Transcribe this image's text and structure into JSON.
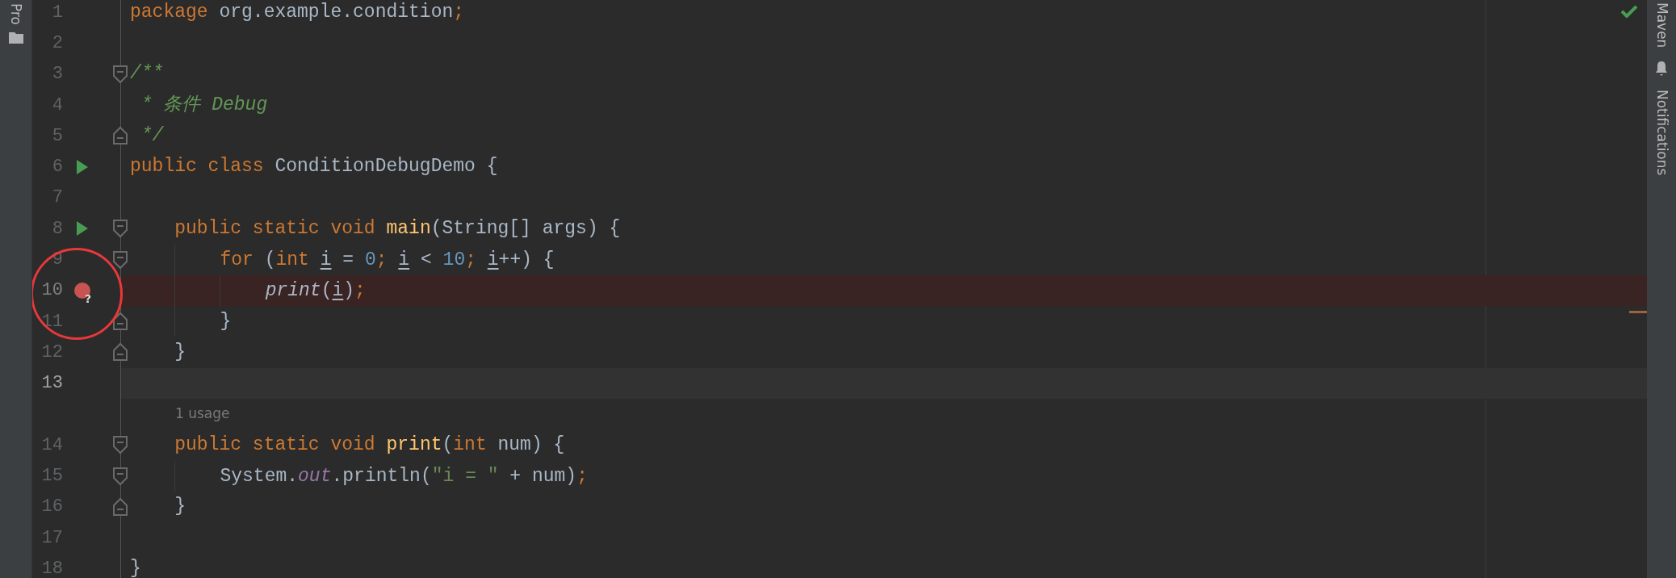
{
  "left_toolbar": {
    "label": "Pro"
  },
  "right_toolbar": {
    "labels": [
      "Maven",
      "Notifications"
    ]
  },
  "editor": {
    "rows": [
      {
        "kind": "code",
        "number": "1",
        "current": false,
        "breakpoint_line": false,
        "run": false,
        "breakpoint": false,
        "fold_start": false,
        "fold_end": false,
        "tokens": [
          {
            "t": "package ",
            "color": "#cc7832"
          },
          {
            "t": "org.example.condition",
            "color": "#a9b7c6"
          },
          {
            "t": ";",
            "color": "#cc7832"
          }
        ]
      },
      {
        "kind": "code",
        "number": "2",
        "current": false,
        "breakpoint_line": false,
        "run": false,
        "breakpoint": false,
        "fold_start": false,
        "fold_end": false
      },
      {
        "kind": "code",
        "number": "3",
        "current": false,
        "breakpoint_line": false,
        "run": false,
        "breakpoint": false,
        "fold_start": true,
        "fold_end": false,
        "tokens": [
          {
            "t": "/**",
            "color": "#629755",
            "italic": true
          }
        ]
      },
      {
        "kind": "code",
        "number": "4",
        "current": false,
        "breakpoint_line": false,
        "run": false,
        "breakpoint": false,
        "fold_start": false,
        "fold_end": false,
        "tokens": [
          {
            "t": " * 条件 Debug",
            "color": "#629755",
            "italic": true
          }
        ]
      },
      {
        "kind": "code",
        "number": "5",
        "current": false,
        "breakpoint_line": false,
        "run": false,
        "breakpoint": false,
        "fold_start": false,
        "fold_end": true,
        "tokens": [
          {
            "t": " */",
            "color": "#629755",
            "italic": true
          }
        ]
      },
      {
        "kind": "code",
        "number": "6",
        "current": false,
        "breakpoint_line": false,
        "run": true,
        "breakpoint": false,
        "fold_start": false,
        "fold_end": false,
        "tokens": [
          {
            "t": "public class ",
            "color": "#cc7832"
          },
          {
            "t": "ConditionDebugDemo {",
            "color": "#a9b7c6"
          }
        ]
      },
      {
        "kind": "code",
        "number": "7",
        "current": false,
        "breakpoint_line": false,
        "run": false,
        "breakpoint": false,
        "fold_start": false,
        "fold_end": false
      },
      {
        "kind": "code",
        "number": "8",
        "current": false,
        "breakpoint_line": false,
        "run": true,
        "breakpoint": false,
        "fold_start": true,
        "fold_end": false,
        "tokens": [
          {
            "t": "    public static void ",
            "color": "#cc7832"
          },
          {
            "t": "main",
            "color": "#ffc66d"
          },
          {
            "t": "(String[] args) {",
            "color": "#a9b7c6"
          }
        ]
      },
      {
        "kind": "code",
        "number": "9",
        "current": false,
        "breakpoint_line": false,
        "run": false,
        "breakpoint": false,
        "fold_start": true,
        "fold_end": false,
        "tokens": [
          {
            "t": "        for ",
            "color": "#cc7832"
          },
          {
            "t": "(",
            "color": "#a9b7c6"
          },
          {
            "t": "int ",
            "color": "#cc7832"
          },
          {
            "t": "i",
            "color": "#a9b7c6",
            "underlined": true
          },
          {
            "t": " = ",
            "color": "#a9b7c6"
          },
          {
            "t": "0",
            "color": "#6897bb"
          },
          {
            "t": "; ",
            "color": "#cc7832"
          },
          {
            "t": "i",
            "color": "#a9b7c6",
            "underlined": true
          },
          {
            "t": " < ",
            "color": "#a9b7c6"
          },
          {
            "t": "10",
            "color": "#6897bb"
          },
          {
            "t": "; ",
            "color": "#cc7832"
          },
          {
            "t": "i",
            "color": "#a9b7c6",
            "underlined": true
          },
          {
            "t": "++) {",
            "color": "#a9b7c6"
          }
        ]
      },
      {
        "kind": "code",
        "number": "10",
        "current": false,
        "breakpoint_line": true,
        "run": false,
        "breakpoint": true,
        "breakpoint_mark": "?",
        "fold_start": false,
        "fold_end": false,
        "tokens": [
          {
            "t": "            print",
            "color": "#a9b7c6",
            "italic": true
          },
          {
            "t": "(",
            "color": "#a9b7c6"
          },
          {
            "t": "i",
            "color": "#a9b7c6",
            "underlined": true
          },
          {
            "t": ")",
            "color": "#a9b7c6"
          },
          {
            "t": ";",
            "color": "#cc7832"
          }
        ]
      },
      {
        "kind": "code",
        "number": "11",
        "current": false,
        "breakpoint_line": false,
        "run": false,
        "breakpoint": false,
        "fold_start": false,
        "fold_end": true,
        "tokens": [
          {
            "t": "        }",
            "color": "#a9b7c6"
          }
        ]
      },
      {
        "kind": "code",
        "number": "12",
        "current": false,
        "breakpoint_line": false,
        "run": false,
        "breakpoint": false,
        "fold_start": false,
        "fold_end": true,
        "tokens": [
          {
            "t": "    }",
            "color": "#a9b7c6"
          }
        ]
      },
      {
        "kind": "code",
        "number": "13",
        "current": true,
        "breakpoint_line": false,
        "run": false,
        "breakpoint": false,
        "fold_start": false,
        "fold_end": false
      },
      {
        "kind": "hint",
        "text": "1 usage"
      },
      {
        "kind": "code",
        "number": "14",
        "current": false,
        "breakpoint_line": false,
        "run": false,
        "breakpoint": false,
        "fold_start": true,
        "fold_end": false,
        "tokens": [
          {
            "t": "    public static void ",
            "color": "#cc7832"
          },
          {
            "t": "print",
            "color": "#ffc66d"
          },
          {
            "t": "(",
            "color": "#a9b7c6"
          },
          {
            "t": "int ",
            "color": "#cc7832"
          },
          {
            "t": "num) {",
            "color": "#a9b7c6"
          }
        ]
      },
      {
        "kind": "code",
        "number": "15",
        "current": false,
        "breakpoint_line": false,
        "run": false,
        "breakpoint": false,
        "fold_start": true,
        "fold_end": false,
        "tokens": [
          {
            "t": "        System.",
            "color": "#a9b7c6"
          },
          {
            "t": "out",
            "color": "#9876aa",
            "italic": true
          },
          {
            "t": ".println(",
            "color": "#a9b7c6"
          },
          {
            "t": "\"i = \"",
            "color": "#6a8759"
          },
          {
            "t": " + num)",
            "color": "#a9b7c6"
          },
          {
            "t": ";",
            "color": "#cc7832"
          }
        ]
      },
      {
        "kind": "code",
        "number": "16",
        "current": false,
        "breakpoint_line": false,
        "run": false,
        "breakpoint": false,
        "fold_start": false,
        "fold_end": true,
        "tokens": [
          {
            "t": "    }",
            "color": "#a9b7c6"
          }
        ]
      },
      {
        "kind": "code",
        "number": "17",
        "current": false,
        "breakpoint_line": false,
        "run": false,
        "breakpoint": false,
        "fold_start": false,
        "fold_end": false
      },
      {
        "kind": "code",
        "number": "18",
        "current": false,
        "breakpoint_line": false,
        "run": false,
        "breakpoint": false,
        "fold_start": false,
        "fold_end": false,
        "tokens": [
          {
            "t": "}",
            "color": "#a9b7c6"
          }
        ]
      }
    ]
  }
}
